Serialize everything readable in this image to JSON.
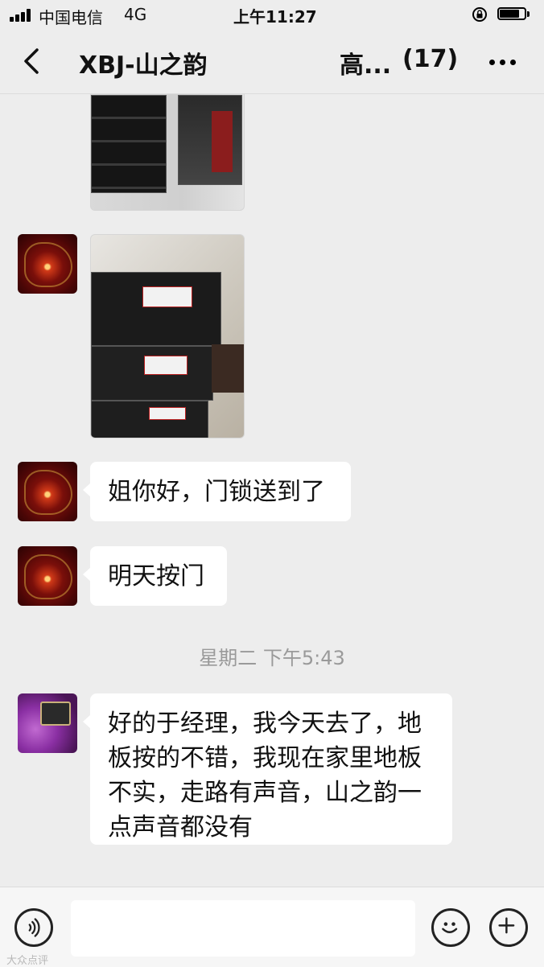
{
  "status_bar": {
    "carrier": "中国电信",
    "network": "4G",
    "time": "上午11:27"
  },
  "header": {
    "title": "XBJ-山之韵",
    "subtitle": "高...",
    "member_count": "(17)"
  },
  "chat": {
    "messages": [
      {
        "type": "image",
        "description_icon": "image-boxes"
      },
      {
        "type": "image",
        "description_icon": "image-boxes"
      },
      {
        "type": "text",
        "text": "姐你好，门锁送到了"
      },
      {
        "type": "text",
        "text": "明天按门"
      },
      {
        "type": "timestamp",
        "text": "星期二 下午5:43"
      },
      {
        "type": "text",
        "text": "好的于经理，我今天去了，地板按的不错，我现在家里地板不实，走路有声音，山之韵一点声音都没有"
      }
    ]
  },
  "input_bar": {
    "voice_icon": "voice-icon",
    "emoji_icon": "emoji-icon",
    "add_icon": "plus-icon",
    "watermark": "大众点评"
  },
  "colors": {
    "background": "#ededed",
    "bubble": "#ffffff",
    "timestamp": "#9a9a9a"
  }
}
